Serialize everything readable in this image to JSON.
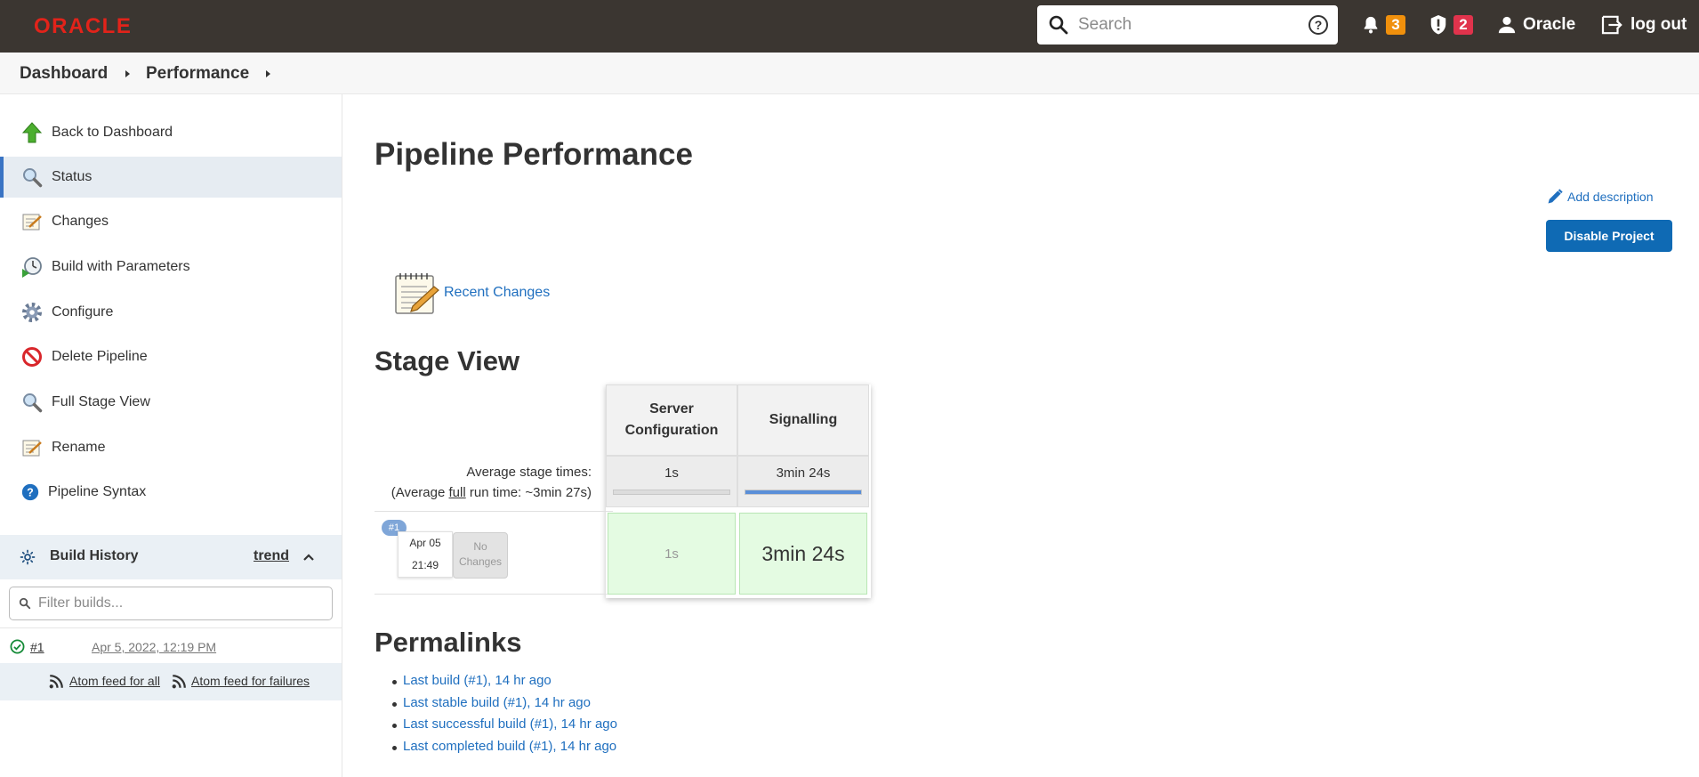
{
  "header": {
    "logo": "ORACLE",
    "search_placeholder": "Search",
    "notifications_count": "3",
    "security_count": "2",
    "user": "Oracle",
    "logout": "log out"
  },
  "breadcrumb": [
    "Dashboard",
    "Performance"
  ],
  "sidebar": {
    "items": [
      {
        "label": "Back to Dashboard",
        "icon": "up-arrow-icon"
      },
      {
        "label": "Status",
        "icon": "magnifier-icon"
      },
      {
        "label": "Changes",
        "icon": "notepad-icon"
      },
      {
        "label": "Build with Parameters",
        "icon": "clock-play-icon"
      },
      {
        "label": "Configure",
        "icon": "gear-icon"
      },
      {
        "label": "Delete Pipeline",
        "icon": "no-entry-icon"
      },
      {
        "label": "Full Stage View",
        "icon": "magnifier-icon"
      },
      {
        "label": "Rename",
        "icon": "notepad-icon"
      },
      {
        "label": "Pipeline Syntax",
        "icon": "help-icon"
      }
    ],
    "build_history": {
      "title": "Build History",
      "trend": "trend",
      "filter_placeholder": "Filter builds...",
      "builds": [
        {
          "number": "#1",
          "date": "Apr 5, 2022, 12:19 PM",
          "status": "success"
        }
      ],
      "feed_all": "Atom feed for all",
      "feed_failures": "Atom feed for failures"
    }
  },
  "main": {
    "title": "Pipeline Performance",
    "add_description": "Add description",
    "disable_button": "Disable Project",
    "recent_changes": "Recent Changes",
    "stage_view": {
      "heading": "Stage View",
      "stages": [
        {
          "name": "Server Configuration",
          "avg": "1s",
          "bar_fill": 0.0,
          "run_value": "1s"
        },
        {
          "name": "Signalling",
          "avg": "3min 24s",
          "bar_fill": 1.0,
          "run_value": "3min 24s"
        }
      ],
      "avg_label_line1": "Average stage times:",
      "avg_label_prefix": "(Average ",
      "avg_label_full": "full",
      "avg_label_suffix": " run time: ~3min 27s)",
      "run": {
        "badge": "#1",
        "date": "Apr 05",
        "time": "21:49",
        "no_changes_1": "No",
        "no_changes_2": "Changes"
      }
    },
    "permalinks": {
      "heading": "Permalinks",
      "links": [
        "Last build (#1), 14 hr ago",
        "Last stable build (#1), 14 hr ago",
        "Last successful build (#1), 14 hr ago",
        "Last completed build (#1), 14 hr ago"
      ]
    }
  },
  "colors": {
    "header_bg": "#3b3631",
    "brand_red": "#e2231a",
    "link": "#1f6fbf",
    "primary_button": "#0f6ab4",
    "success_cell": "#e4fbe2"
  }
}
